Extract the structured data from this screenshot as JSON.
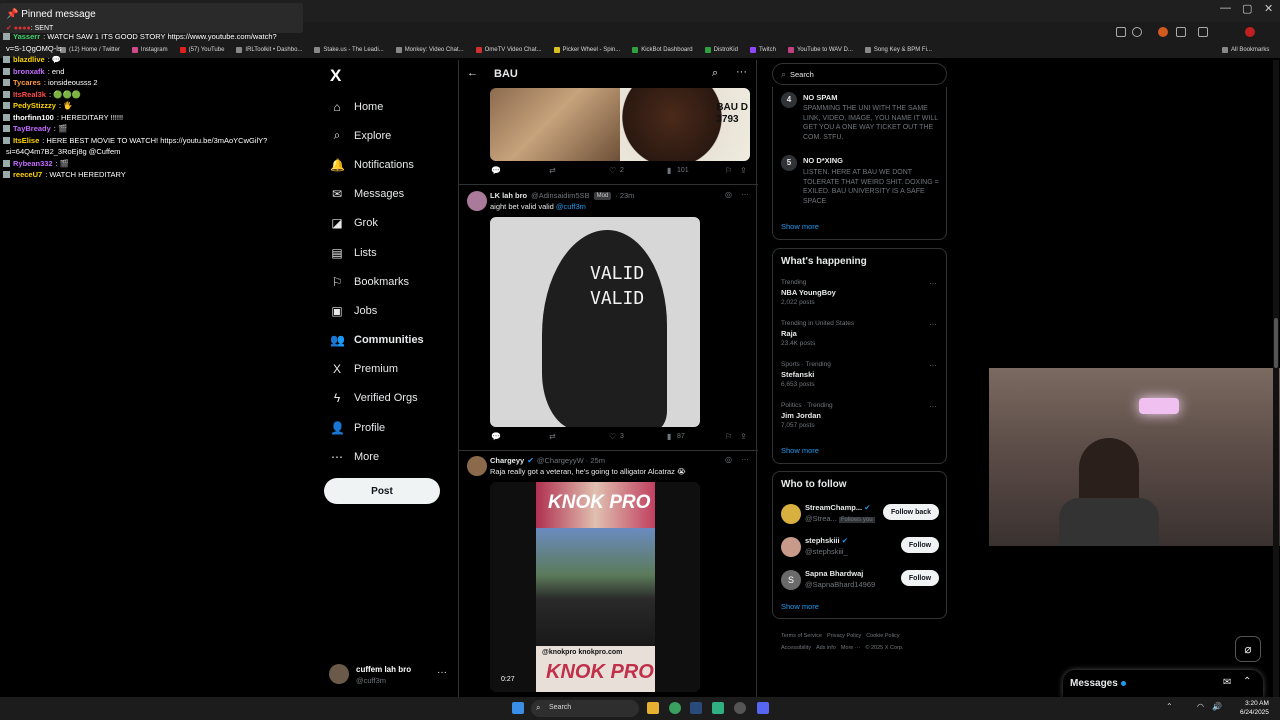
{
  "browser": {
    "bookmarks": [
      "(12) Home / Twitter",
      "Instagram",
      "(57) YouTube",
      "IRLToolkit • Dashbo...",
      "Stake.us - The Leadi...",
      "Monkey: Video Chat...",
      "OmeTV Video Chat...",
      "Picker Wheel - Spin...",
      "KickBot Dashboard",
      "DistroKid",
      "Twitch",
      "YouTube to WAV D...",
      "Song Key & BPM Fi..."
    ],
    "all_bookmarks": "All Bookmarks"
  },
  "chat": {
    "pinned_title": "Pinned message",
    "pinned_text": ": SENT",
    "messages": [
      {
        "user": "Yasserr",
        "text": ": WATCH SAW 1 ITS GOOD STORY https://www.youtube.com/watch?",
        "color": "#3fd46c"
      },
      {
        "user": "",
        "text": "v=S-1QgOMQ-ls",
        "color": "#ffffff"
      },
      {
        "user": "blazdlive",
        "text": ": 💬",
        "color": "#ffd700"
      },
      {
        "user": "bronxafk",
        "text": ": end",
        "color": "#c36bff"
      },
      {
        "user": "Tycares",
        "text": ": ionsideousss 2",
        "color": "#ff9a3c"
      },
      {
        "user": "ItsReal3k",
        "text": ": 🟢🟢🟢",
        "color": "#ff4b4b"
      },
      {
        "user": "PedyStizzzy",
        "text": ": 🖐",
        "color": "#ffd700"
      },
      {
        "user": "thorfinn100",
        "text": ": HEREDITARY !!!!!!",
        "color": "#ffffff"
      },
      {
        "user": "TayBready",
        "text": ": 🎬",
        "color": "#c36bff"
      },
      {
        "user": "ItsElise",
        "text": ": HERE BEST MOVIE TO WATCH! https://youtu.be/3mAoYCwGilY?",
        "color": "#ffd700"
      },
      {
        "user": "",
        "text": "si=64Q4m7B2_3RoEj8g @Cuffem",
        "color": "#ffffff"
      },
      {
        "user": "Rybean332",
        "text": ": 🎬",
        "color": "#c36bff"
      },
      {
        "user": "reeceU7",
        "text": ": WATCH HEREDITARY",
        "color": "#ffd700"
      }
    ]
  },
  "sidebar": {
    "logo": "X",
    "items": [
      {
        "label": "Home",
        "icon": "⌂",
        "name": "home"
      },
      {
        "label": "Explore",
        "icon": "⌕",
        "name": "explore"
      },
      {
        "label": "Notifications",
        "icon": "🔔",
        "name": "notifications"
      },
      {
        "label": "Messages",
        "icon": "✉",
        "name": "messages"
      },
      {
        "label": "Grok",
        "icon": "◪",
        "name": "grok"
      },
      {
        "label": "Lists",
        "icon": "▤",
        "name": "lists"
      },
      {
        "label": "Bookmarks",
        "icon": "⚐",
        "name": "bookmarks"
      },
      {
        "label": "Jobs",
        "icon": "▣",
        "name": "jobs"
      },
      {
        "label": "Communities",
        "icon": "👥",
        "name": "communities"
      },
      {
        "label": "Premium",
        "icon": "X",
        "name": "premium"
      },
      {
        "label": "Verified Orgs",
        "icon": "ϟ",
        "name": "verified-orgs"
      },
      {
        "label": "Profile",
        "icon": "👤",
        "name": "profile"
      },
      {
        "label": "More",
        "icon": "⋯",
        "name": "more"
      }
    ],
    "post_label": "Post",
    "account_name": "cuffem lah bro",
    "account_handle": "@cuff3m"
  },
  "feed": {
    "title": "BAU",
    "first_post_image_text": "BAU D\n3793",
    "first_post_stats": {
      "likes": "2",
      "views": "101"
    },
    "post2": {
      "name": "LK lah bro",
      "handle": "@Adinsaidim5SB",
      "badge": "Mod",
      "time": "· 23m",
      "text": "aight bet valid valid ",
      "mention": "@cuff3m",
      "image_text": [
        "VALID",
        "VALID"
      ],
      "likes": "3",
      "views": "87"
    },
    "post3": {
      "name": "Chargeyy",
      "handle": "@ChargeyyW · 25m",
      "text": "Raja really got a veteran, he's going to alligator Alcatraz 😭",
      "video_top": "KNOK PRO",
      "video_url": "@knokpro  knokpro.com",
      "video_bottom": "KNOK PRO",
      "video_time": "0:27"
    }
  },
  "right": {
    "search_placeholder": "Search",
    "rules": [
      {
        "num": "4",
        "title": "NO SPAM",
        "body": "SPAMMING THE UNI WITH THE SAME LINK, VIDEO, IMAGE, YOU NAME IT WILL GET YOU A ONE WAY TICKET OUT THE COM. STFU."
      },
      {
        "num": "5",
        "title": "NO D*XING",
        "body": "LISTEN. HERE AT BAU WE DONT TOLERATE THAT WEIRD SHIT. DOXING = EXILED. BAU UNIVERSITY IS A SAFE SPACE"
      }
    ],
    "show_more": "Show more",
    "happening_title": "What's happening",
    "trends": [
      {
        "cat": "Trending",
        "name": "NBA YoungBoy",
        "count": "2,022 posts"
      },
      {
        "cat": "Trending in United States",
        "name": "Raja",
        "count": "23.4K posts"
      },
      {
        "cat": "Sports · Trending",
        "name": "Stefanski",
        "count": "6,653 posts"
      },
      {
        "cat": "Politics · Trending",
        "name": "Jim Jordan",
        "count": "7,057 posts"
      }
    ],
    "wtf_title": "Who to follow",
    "follows": [
      {
        "name": "StreamChamp...",
        "handle": "@Strea...",
        "tag": "Follows you",
        "button": "Follow back",
        "color": "#d8b040"
      },
      {
        "name": "stephskiii",
        "handle": "@stephskiii_",
        "tag": "",
        "button": "Follow",
        "color": "#c89a8a"
      },
      {
        "name": "Sapna Bhardwaj",
        "handle": "@SapnaBhard14969",
        "tag": "",
        "button": "Follow",
        "color": "#6a6a6a",
        "initial": "S"
      }
    ],
    "footer": [
      "Terms of Service",
      "Privacy Policy",
      "Cookie Policy",
      "Accessibility",
      "Ads info",
      "More ···",
      "© 2025 X Corp."
    ]
  },
  "drawer": {
    "messages": "Messages"
  },
  "taskbar": {
    "search": "Search",
    "time": "3:20 AM",
    "date": "6/24/2025"
  }
}
